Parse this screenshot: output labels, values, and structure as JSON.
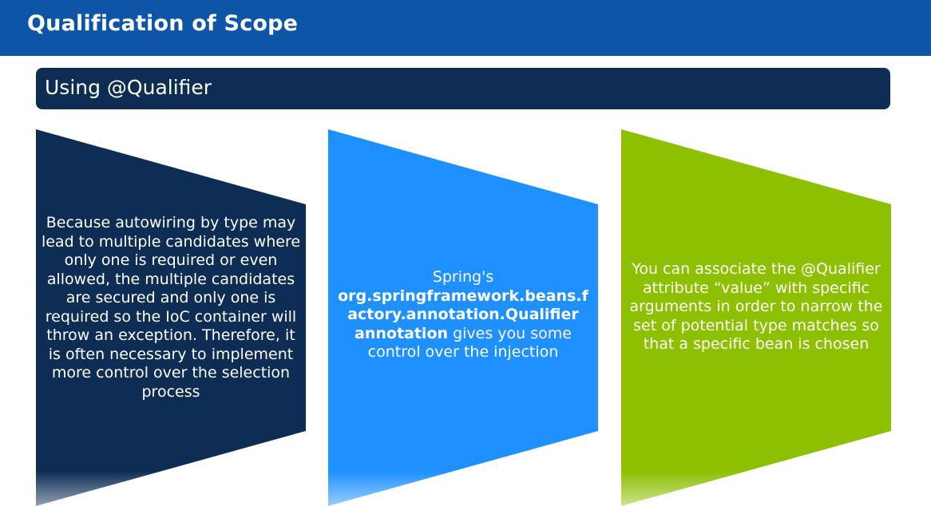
{
  "slide": {
    "title": "Qualification of Scope",
    "section_label": "Using @Qualifier"
  },
  "colors": {
    "title_bar": "#0e55a8",
    "section_header": "#0d2d55",
    "panel_1": "#0d2d55",
    "panel_2": "#1e90ff",
    "panel_3": "#8cc000",
    "text": "#ffffff"
  },
  "panels": [
    {
      "text": "Because autowiring by type may lead to multiple candidates where only one is required or even allowed, the multiple candidates are secured and only one is required so the IoC container will throw an exception. Therefore, it is often necessary to implement more control over the selection process"
    },
    {
      "text_prefix": "Spring's",
      "text_bold_1": "org.springframework.beans.f actory.annotation.Qualifier",
      "text_bold_2": "annotation",
      "text_suffix": "gives you some control over the injection"
    },
    {
      "text": "You can associate the @Qualifier attribute “value” with specific arguments in order to narrow the set of potential type matches so that a specific bean is chosen"
    }
  ]
}
